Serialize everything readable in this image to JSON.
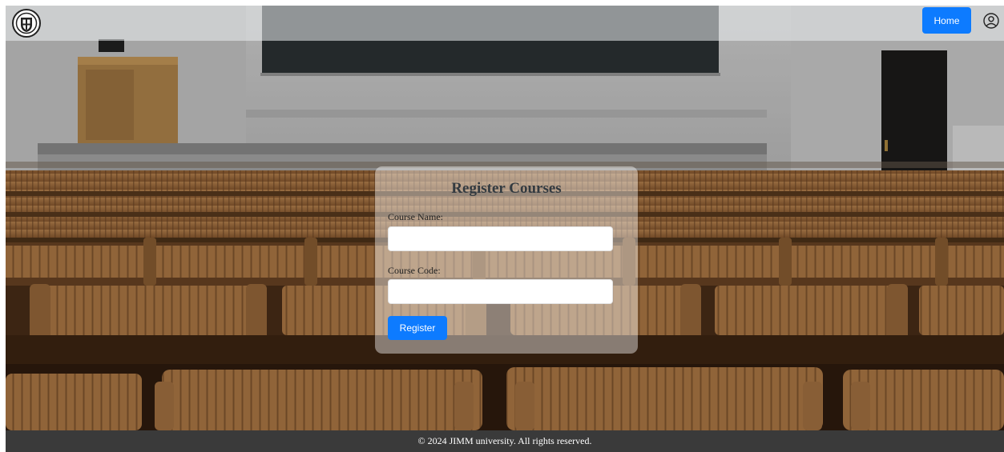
{
  "navbar": {
    "home_label": "Home"
  },
  "form": {
    "title": "Register Courses",
    "course_name_label": "Course Name:",
    "course_name_value": "",
    "course_code_label": "Course Code:",
    "course_code_value": "",
    "submit_label": "Register"
  },
  "footer": {
    "text": "© 2024 JIMM university. All rights reserved."
  },
  "icons": {
    "logo": "university-seal-icon",
    "user": "user-circle-icon"
  },
  "colors": {
    "accent": "#0d7bff",
    "footer_bg": "#3a3a3a",
    "navbar_bg": "#ebeef0",
    "card_bg": "#ffffff"
  }
}
